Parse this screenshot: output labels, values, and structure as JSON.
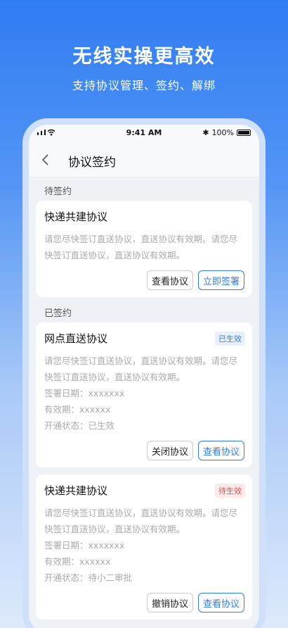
{
  "promo": {
    "title": "无线实操更高效",
    "subtitle": "支持协议管理、签约、解绑"
  },
  "status_bar": {
    "time": "9:41 AM",
    "battery": "100%",
    "bluetooth_symbol": "✱"
  },
  "nav": {
    "title": "协议签约"
  },
  "sections": {
    "pending_label": "待签约",
    "signed_label": "已签约"
  },
  "pending_card": {
    "title": "快递共建协议",
    "desc_line1": "请您尽快签订直送协议，直送协议有效期。请您尽",
    "desc_line2": "快签订直送协议，直送协议有效期。",
    "view_button": "查看协议",
    "sign_button": "立即签署"
  },
  "signed_cards": [
    {
      "title": "网点直送协议",
      "badge": "已生效",
      "desc_line1": "请您尽快签订直送协议，直送协议有效期。请您尽",
      "desc_line2": "快签订直送协议，直送协议有效期。",
      "sign_date": "签署日期：xxxxxxx",
      "validity": "有效期：xxxxxx",
      "status": "开通状态：已生效",
      "secondary_button": "关闭协议",
      "primary_button": "查看协议"
    },
    {
      "title": "快递共建协议",
      "badge": "待生效",
      "desc_line1": "请您尽快签订直送协议，直送协议有效期。请您尽",
      "desc_line2": "快签订直送协议，直送协议有效期。",
      "sign_date": "签署日期：xxxxxxx",
      "validity": "有效期：xxxxxx",
      "status": "开通状态：待小二审批",
      "secondary_button": "撤销协议",
      "primary_button": "查看协议"
    }
  ],
  "colors": {
    "accent": "#2f7cf2",
    "badge_active": "#2f7cf2",
    "badge_pending": "#e24a4a"
  }
}
